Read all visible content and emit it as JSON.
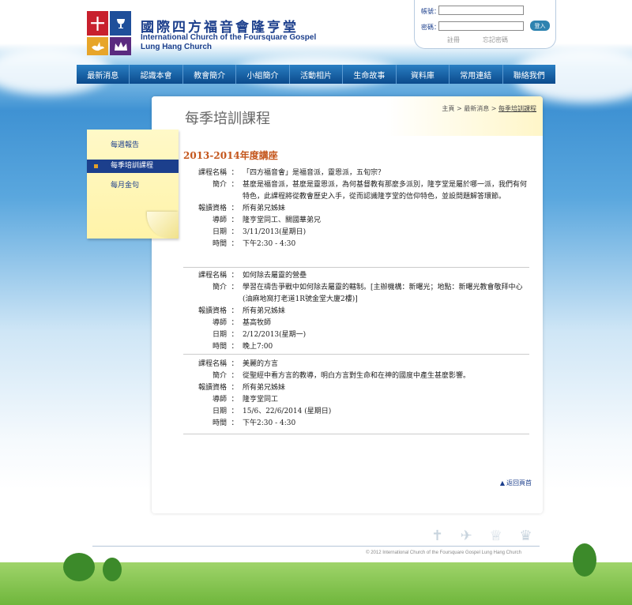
{
  "header": {
    "logo_glyphs": [
      "十",
      "",
      "",
      ""
    ],
    "church_name_zh": "國際四方福音會隆亨堂",
    "church_name_en_line1": "International Church of the Foursquare Gospel",
    "church_name_en_line2": "Lung Hang Church"
  },
  "login": {
    "account_label": "帳號：",
    "password_label": "密碼：",
    "login_button": "登入",
    "register_link": "註冊",
    "forgot_link": "忘記密碼"
  },
  "nav": {
    "items": [
      "最新消息",
      "認識本會",
      "教會簡介",
      "小組簡介",
      "活動相片",
      "生命故事",
      "資料庫",
      "常用連結",
      "聯絡我們"
    ]
  },
  "sidebar": {
    "items": [
      "每週報告",
      "每季培訓課程",
      "每月金句"
    ],
    "active_index": 1
  },
  "content": {
    "page_title": "每季培訓課程",
    "breadcrumb": [
      "主頁",
      "最新消息",
      "每季培訓課程"
    ],
    "breadcrumb_sep": " > ",
    "section_title": "2013-2014年度講座",
    "colon": "：",
    "courses": [
      {
        "rows": [
          {
            "k": "課程名稱",
            "v": "「四方福音會」是福音派，靈恩派，五旬宗？"
          },
          {
            "k": "簡介",
            "v": "甚麼是福音派，甚麼是靈恩派，為何基督教有那麼多派別，隆亨堂是屬於哪一派，我們有何特色，此課程將從教會歷史入手，從而認識隆亨堂的信仰特色，並設問題解答環節。"
          },
          {
            "k": "報讀資格",
            "v": "所有弟兄姊妹"
          },
          {
            "k": "導師",
            "v": "隆亨堂同工、關國華弟兄"
          },
          {
            "k": "日期",
            "v": "3/11/2013(星期日)"
          },
          {
            "k": "時間",
            "v": "下午2:30 - 4:30"
          }
        ]
      },
      {
        "rows": [
          {
            "k": "課程名稱",
            "v": "如何除去屬靈的營壘"
          },
          {
            "k": "簡介",
            "v": "學習在禱告爭戰中如何除去屬靈的轄制。[主辦機構：新曙光；地點：新曙光教會敬拜中心(油麻地窩打老道1R號金堂大廈2樓)]"
          },
          {
            "k": "報讀資格",
            "v": "所有弟兄姊妹"
          },
          {
            "k": "導師",
            "v": "基高牧師"
          },
          {
            "k": "日期",
            "v": "2/12/2013(星期一)"
          },
          {
            "k": "時間",
            "v": "晚上7:00"
          }
        ]
      },
      {
        "rows": [
          {
            "k": "課程名稱",
            "v": "美麗的方言"
          },
          {
            "k": "簡介",
            "v": "從聖經中看方言的教導，明白方言對生命和在神的國度中產生甚麼影響。"
          },
          {
            "k": "報讀資格",
            "v": "所有弟兄姊妹"
          },
          {
            "k": "導師",
            "v": "隆亨堂同工"
          },
          {
            "k": "日期",
            "v": "15/6、22/6/2014 (星期日)"
          },
          {
            "k": "時間",
            "v": "下午2:30 - 4:30"
          }
        ]
      }
    ],
    "back_to_top": "返回頁首"
  },
  "footer": {
    "copyright": "© 2012 International Church of the Foursquare Gospel Lung Hang Church",
    "icons": "✝ ✈ ♕ ♛"
  }
}
